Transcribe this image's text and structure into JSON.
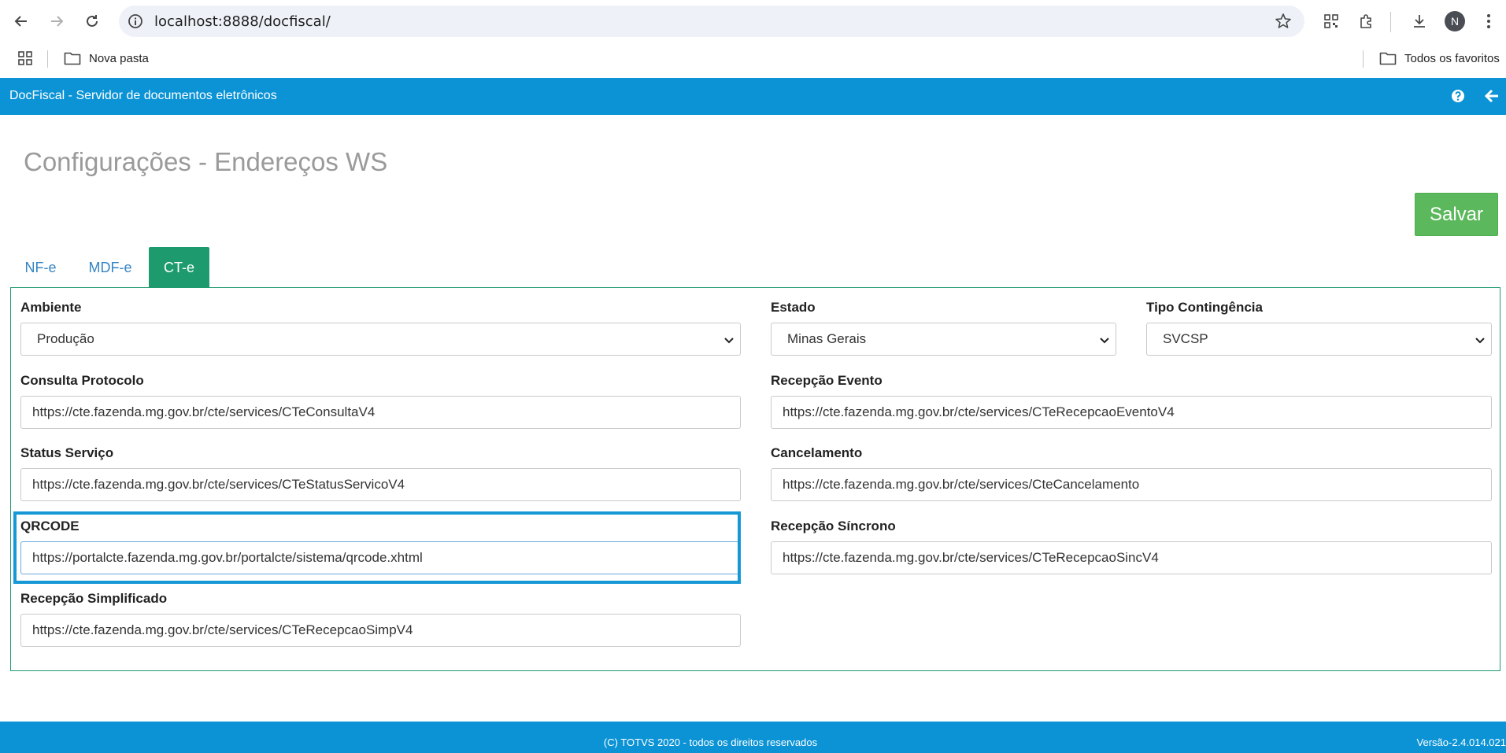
{
  "browser": {
    "url": "localhost:8888/docfiscal/",
    "bookmarks": [
      {
        "label": "Nova pasta"
      },
      {
        "label": "Todos os favoritos"
      }
    ],
    "avatar_initial": "N"
  },
  "app": {
    "title": "DocFiscal - Servidor de documentos eletrônicos",
    "accent_color": "#0b93d5"
  },
  "page": {
    "title": "Configurações - Endereços WS",
    "save_label": "Salvar"
  },
  "tabs": [
    {
      "label": "NF-e",
      "active": false
    },
    {
      "label": "MDF-e",
      "active": false
    },
    {
      "label": "CT-e",
      "active": true
    }
  ],
  "form": {
    "ambiente": {
      "label": "Ambiente",
      "value": "Produção"
    },
    "estado": {
      "label": "Estado",
      "value": "Minas Gerais"
    },
    "tipo_contingencia": {
      "label": "Tipo Contingência",
      "value": "SVCSP"
    },
    "consulta_protocolo": {
      "label": "Consulta Protocolo",
      "value": "https://cte.fazenda.mg.gov.br/cte/services/CTeConsultaV4"
    },
    "recepcao_evento": {
      "label": "Recepção Evento",
      "value": "https://cte.fazenda.mg.gov.br/cte/services/CTeRecepcaoEventoV4"
    },
    "status_servico": {
      "label": "Status Serviço",
      "value": "https://cte.fazenda.mg.gov.br/cte/services/CTeStatusServicoV4"
    },
    "cancelamento": {
      "label": "Cancelamento",
      "value": "https://cte.fazenda.mg.gov.br/cte/services/CteCancelamento"
    },
    "qrcode": {
      "label": "QRCODE",
      "value": "https://portalcte.fazenda.mg.gov.br/portalcte/sistema/qrcode.xhtml"
    },
    "recepcao_sincrono": {
      "label": "Recepção Síncrono",
      "value": "https://cte.fazenda.mg.gov.br/cte/services/CTeRecepcaoSincV4"
    },
    "recepcao_simplificado": {
      "label": "Recepção Simplificado",
      "value": "https://cte.fazenda.mg.gov.br/cte/services/CTeRecepcaoSimpV4"
    }
  },
  "footer": {
    "copyright": "(C) TOTVS 2020 - todos os direitos reservados",
    "version": "Versão-2.4.014.021"
  }
}
